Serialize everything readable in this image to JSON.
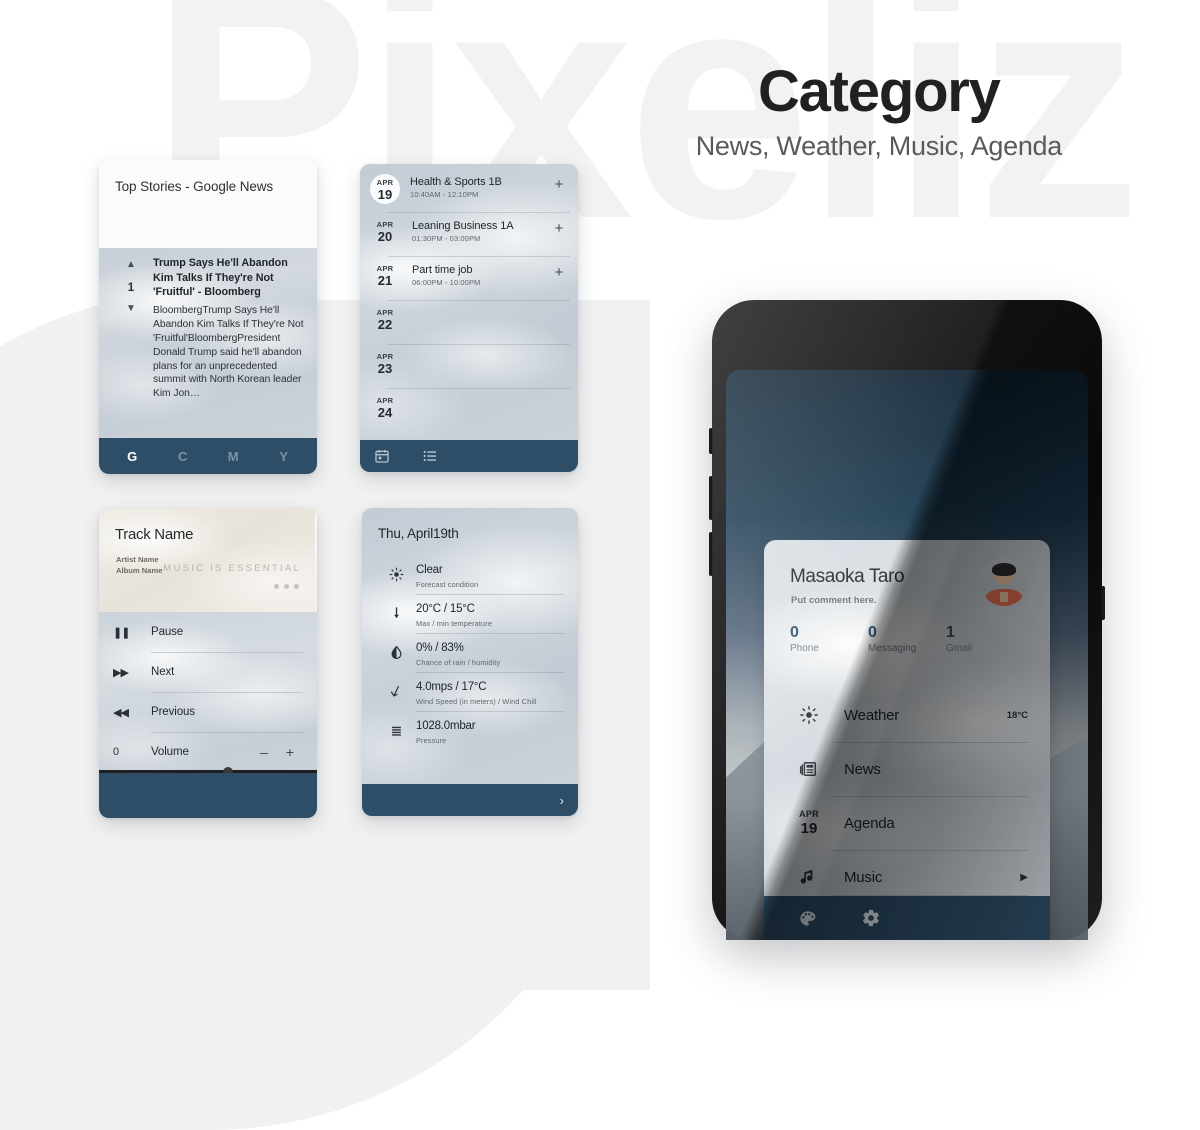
{
  "background": {
    "watermark": "Pixeliz",
    "watermark_color": "#f2f2f2",
    "page_background": "#ffffff",
    "blob_color": "#f1f1f1"
  },
  "header": {
    "title": "Category",
    "subtitle": "News, Weather, Music, Agenda",
    "title_color": "#212121",
    "subtitle_color": "#5a5a5a"
  },
  "theme": {
    "accent_dark_blue": "#2e4e68",
    "widget_glass": "#c9d2da",
    "count_blue": "#2f5271"
  },
  "news_widget": {
    "header_title": "Top Stories - Google News",
    "story": {
      "vote_up_icon": "caret-up-icon",
      "vote_down_icon": "caret-down-icon",
      "vote_count": "1",
      "title": "Trump Says He'll Abandon Kim Talks If They're Not 'Fruitful' - Bloomberg",
      "snippet": "BloombergTrump Says He'll Abandon Kim Talks If They're Not 'Fruitful'BloombergPresident Donald Trump said he'll abandon plans for an unprecedented summit with North Korean leader Kim Jon…"
    },
    "tabs": [
      {
        "label": "G",
        "active": true
      },
      {
        "label": "C",
        "active": false
      },
      {
        "label": "M",
        "active": false
      },
      {
        "label": "Y",
        "active": false
      }
    ]
  },
  "agenda_widget": {
    "rows": [
      {
        "month": "APR",
        "day": "19",
        "circled": true,
        "title": "Health & Sports 1B",
        "time": "10:40AM - 12:10PM",
        "add": "+"
      },
      {
        "month": "APR",
        "day": "20",
        "circled": false,
        "title": "Leaning Business 1A",
        "time": "01:30PM - 03:00PM",
        "add": "+"
      },
      {
        "month": "APR",
        "day": "21",
        "circled": false,
        "title": "Part time job",
        "time": "06:00PM - 10:00PM",
        "add": "+"
      },
      {
        "month": "APR",
        "day": "22",
        "circled": false,
        "title": "",
        "time": "",
        "add": ""
      },
      {
        "month": "APR",
        "day": "23",
        "circled": false,
        "title": "",
        "time": "",
        "add": ""
      },
      {
        "month": "APR",
        "day": "24",
        "circled": false,
        "title": "",
        "time": "",
        "add": ""
      }
    ],
    "nav": [
      {
        "icon": "calendar-icon"
      },
      {
        "icon": "list-icon"
      }
    ]
  },
  "music_widget": {
    "track_name": "Track Name",
    "artist_name": "Artist Name",
    "album_name": "Album Name",
    "art_caption": "MUSIC IS ESSENTIAL",
    "controls": [
      {
        "icon": "pause-icon",
        "glyph": "❚❚",
        "label": "Pause"
      },
      {
        "icon": "next-icon",
        "glyph": "▶▶",
        "label": "Next"
      },
      {
        "icon": "previous-icon",
        "glyph": "◀◀",
        "label": "Previous"
      }
    ],
    "volume": {
      "value": "0",
      "label": "Volume",
      "minus": "–",
      "plus": "+"
    },
    "progress_percent": 57
  },
  "weather_widget": {
    "date": "Thu, April19th",
    "rows": [
      {
        "icon": "sun-icon",
        "value": "Clear",
        "caption": "Forecast condition"
      },
      {
        "icon": "thermometer-icon",
        "value": "20°C / 15°C",
        "caption": "Max / min temperature"
      },
      {
        "icon": "droplet-icon",
        "value": "0% / 83%",
        "caption": "Chance of rain / humidity"
      },
      {
        "icon": "wind-arrow-icon",
        "value": "4.0mps / 17°C",
        "caption": "Wind Speed (in meters) / Wind Chill"
      },
      {
        "icon": "pressure-icon",
        "value": "1028.0mbar",
        "caption": "Pressure"
      }
    ],
    "next_arrow": "›"
  },
  "phone_widget": {
    "user_name": "Masaoka Taro",
    "comment": "Put comment here.",
    "avatar": "user-avatar",
    "counts": [
      {
        "number": "0",
        "label": "Phone"
      },
      {
        "number": "0",
        "label": "Messaging"
      },
      {
        "number": "1",
        "label": "Gmail"
      }
    ],
    "rows": [
      {
        "icon": "sun-icon",
        "label": "Weather",
        "right": "18°C",
        "arrow": ""
      },
      {
        "icon": "news-icon",
        "label": "News",
        "right": "",
        "arrow": ""
      },
      {
        "icon": "date-icon",
        "label": "Agenda",
        "right": "",
        "arrow": "",
        "date_month": "APR",
        "date_day": "19"
      },
      {
        "icon": "music-note-icon",
        "label": "Music",
        "right": "",
        "arrow": "▶"
      }
    ],
    "bar": [
      {
        "icon": "palette-icon"
      },
      {
        "icon": "gear-icon"
      }
    ]
  }
}
